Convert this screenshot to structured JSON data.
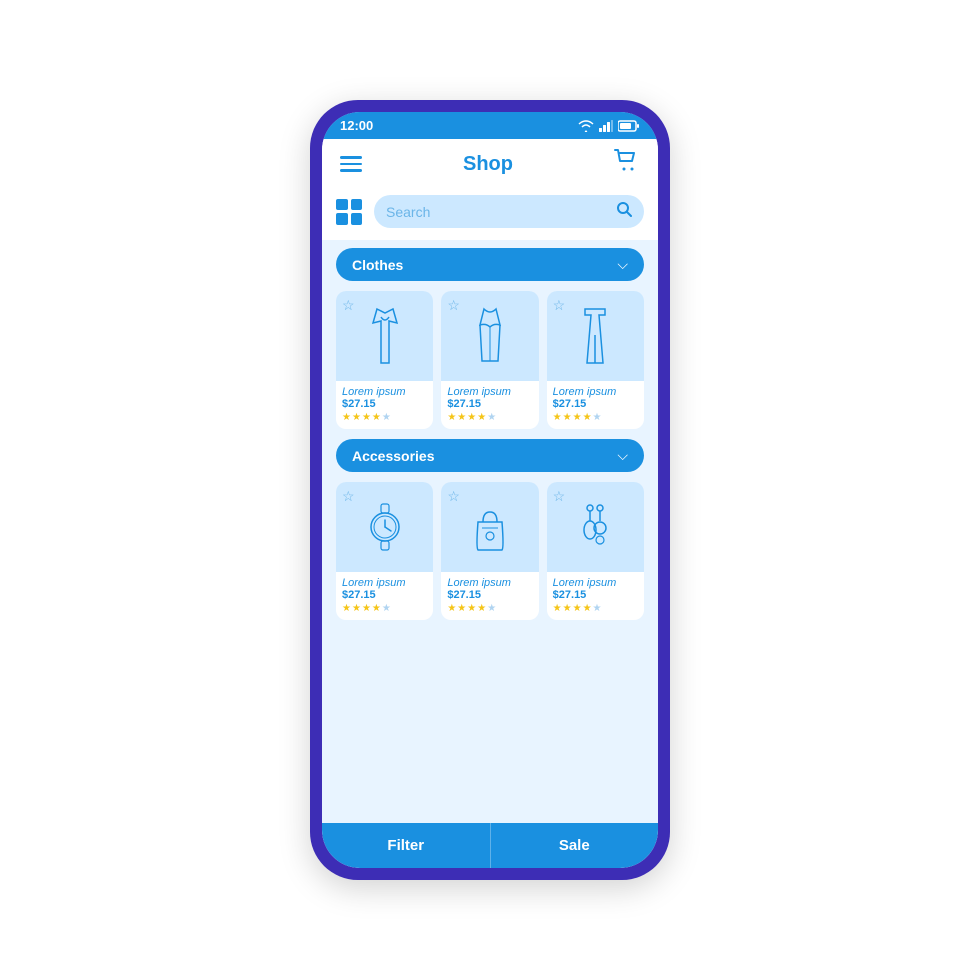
{
  "status": {
    "time": "12:00",
    "wifi": "wifi",
    "signal": "signal",
    "battery": "battery"
  },
  "header": {
    "title": "Shop",
    "cart_label": "cart"
  },
  "search": {
    "placeholder": "Search"
  },
  "categories": [
    {
      "label": "Clothes",
      "products": [
        {
          "name": "Lorem ipsum",
          "price": "$27.15",
          "type": "dress",
          "stars": 4
        },
        {
          "name": "Lorem ipsum",
          "price": "$27.15",
          "type": "bodysuit",
          "stars": 4
        },
        {
          "name": "Lorem ipsum",
          "price": "$27.15",
          "type": "pants",
          "stars": 4
        }
      ]
    },
    {
      "label": "Accessories",
      "products": [
        {
          "name": "Lorem ipsum",
          "price": "$27.15",
          "type": "watch",
          "stars": 4
        },
        {
          "name": "Lorem ipsum",
          "price": "$27.15",
          "type": "bag",
          "stars": 4
        },
        {
          "name": "Lorem ipsum",
          "price": "$27.15",
          "type": "earrings",
          "stars": 4
        }
      ]
    }
  ],
  "bottom_bar": {
    "filter_label": "Filter",
    "sale_label": "Sale"
  }
}
